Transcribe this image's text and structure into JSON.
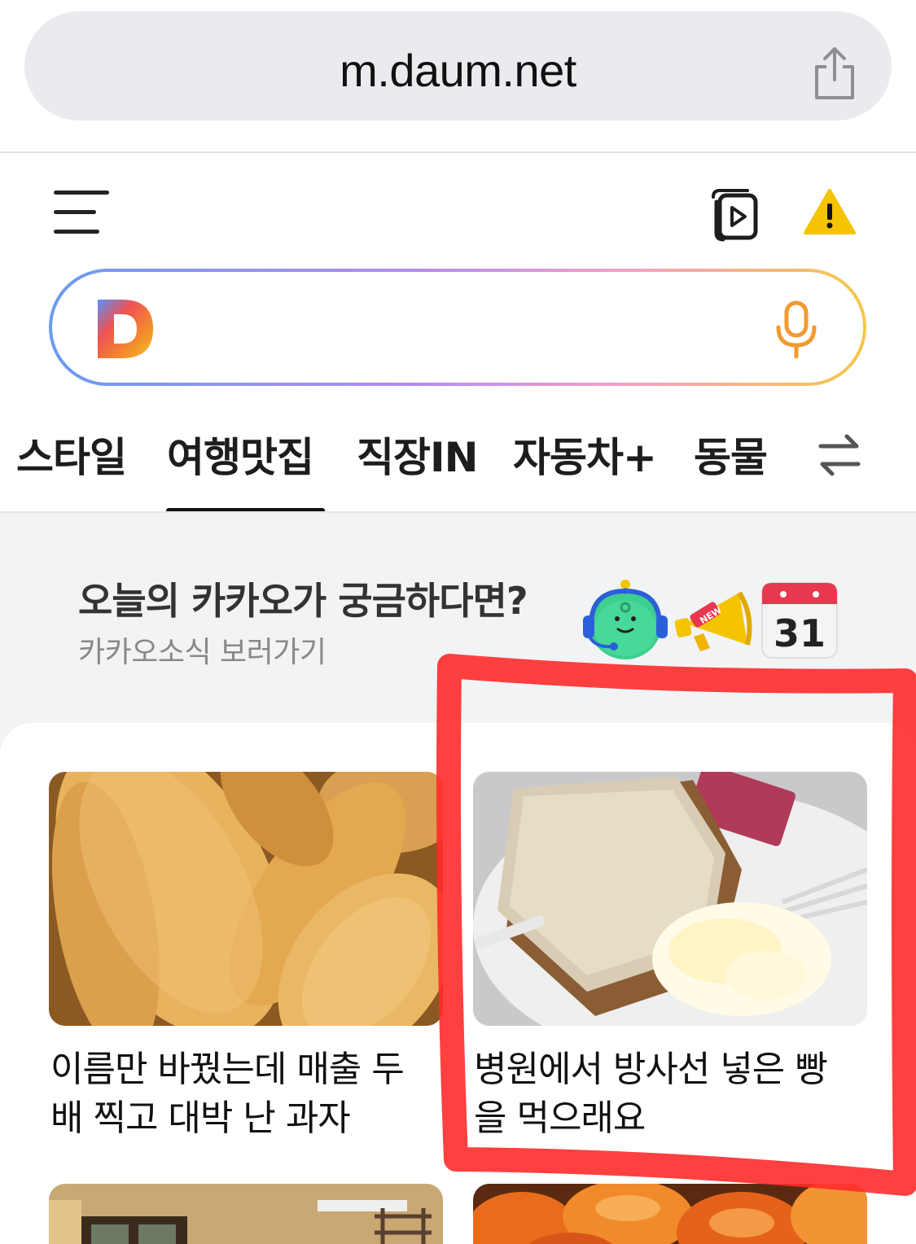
{
  "browser": {
    "url": "m.daum.net",
    "share_icon": "share-icon"
  },
  "header": {
    "menu_icon": "hamburger-menu-icon",
    "video_icon": "video-play-icon",
    "warning_icon": "warning-icon"
  },
  "search": {
    "logo": "daum-d-logo",
    "placeholder": "",
    "mic_icon": "microphone-icon"
  },
  "tabs": {
    "items": [
      {
        "label": "스타일"
      },
      {
        "label": "여행맛집"
      },
      {
        "label": "직장IN"
      },
      {
        "label": "자동차+"
      },
      {
        "label": "동물"
      }
    ],
    "active_index": 1,
    "swap_icon": "swap-arrows-icon"
  },
  "kakao_banner": {
    "title": "오늘의 카카오가 궁금하다면?",
    "subtitle": "카카오소식 보러가기",
    "calendar_number": "31",
    "new_badge": "NEW",
    "icons": [
      "character-headset-icon",
      "megaphone-icon",
      "calendar-icon"
    ]
  },
  "news": {
    "items": [
      {
        "title_line1": "이름만 바꿨는데 매출 두",
        "title_line2": "배 찍고 대박 난 과자"
      },
      {
        "title_line1": "병원에서 방사선 넣은 빵",
        "title_line2": "을 먹으래요"
      }
    ]
  },
  "colors": {
    "annotation": "#ff2b2b",
    "search_gradient": [
      "#6a9bf2",
      "#b58bef",
      "#f1a0c7",
      "#f5c84a"
    ],
    "warning": "#f5c400"
  }
}
